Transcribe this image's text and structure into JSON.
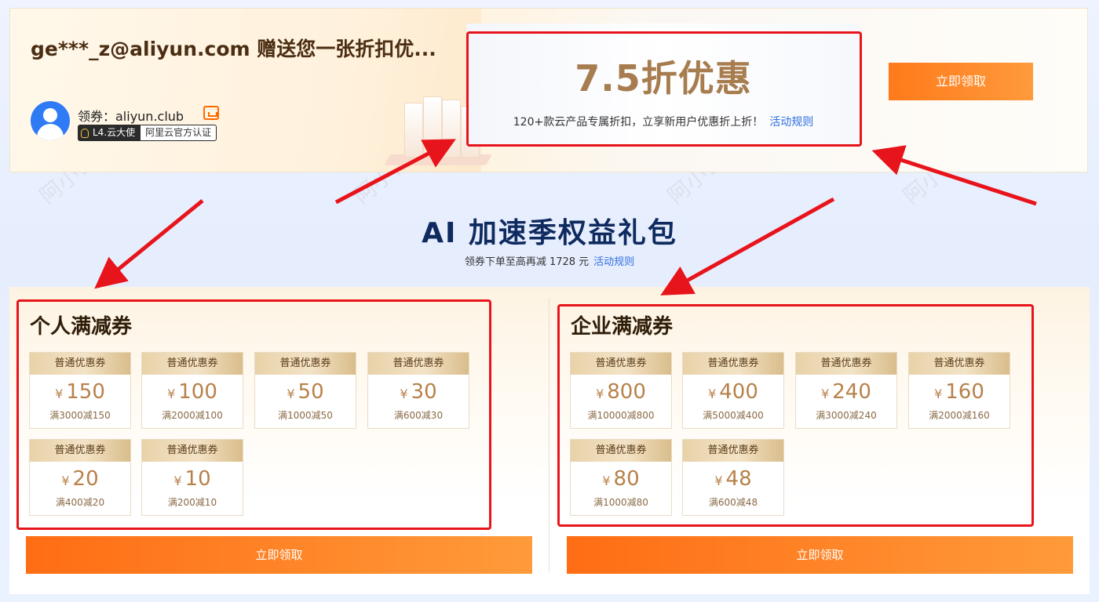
{
  "banner": {
    "title": "ge***_z@aliyun.com 赠送您一张折扣优...",
    "receiver_label": "领券：aliyun.club",
    "badge_level": "L4.云大使",
    "badge_cert": "阿里云官方认证",
    "discount_title": "7.5折优惠",
    "discount_desc": "120+款云产品专属折扣，立享新用户优惠折上折！",
    "discount_rule_link": "活动规则",
    "claim_label": "立即领取"
  },
  "section": {
    "title": "AI 加速季权益礼包",
    "subtitle": "领券下单至高再减 1728 元",
    "rule_link": "活动规则"
  },
  "personal": {
    "title": "个人满减券",
    "claim_label": "立即领取",
    "coupons": [
      {
        "head": "普通优惠券",
        "yen": "¥",
        "amount": "150",
        "rule": "满3000减150"
      },
      {
        "head": "普通优惠券",
        "yen": "¥",
        "amount": "100",
        "rule": "满2000减100"
      },
      {
        "head": "普通优惠券",
        "yen": "¥",
        "amount": "50",
        "rule": "满1000减50"
      },
      {
        "head": "普通优惠券",
        "yen": "¥",
        "amount": "30",
        "rule": "满600减30"
      },
      {
        "head": "普通优惠券",
        "yen": "¥",
        "amount": "20",
        "rule": "满400减20"
      },
      {
        "head": "普通优惠券",
        "yen": "¥",
        "amount": "10",
        "rule": "满200减10"
      }
    ]
  },
  "enterprise": {
    "title": "企业满减券",
    "claim_label": "立即领取",
    "coupons": [
      {
        "head": "普通优惠券",
        "yen": "¥",
        "amount": "800",
        "rule": "满10000减800"
      },
      {
        "head": "普通优惠券",
        "yen": "¥",
        "amount": "400",
        "rule": "满5000减400"
      },
      {
        "head": "普通优惠券",
        "yen": "¥",
        "amount": "240",
        "rule": "满3000减240"
      },
      {
        "head": "普通优惠券",
        "yen": "¥",
        "amount": "160",
        "rule": "满2000减160"
      },
      {
        "head": "普通优惠券",
        "yen": "¥",
        "amount": "80",
        "rule": "满1000减80"
      },
      {
        "head": "普通优惠券",
        "yen": "¥",
        "amount": "48",
        "rule": "满600减48"
      }
    ]
  },
  "watermark": "阿小云 axiaoyun.com",
  "colors": {
    "accent_orange": "#ff7a1a",
    "gold_text": "#a77c4f",
    "link_blue": "#2f6ee0",
    "annotation_red": "#e8141b",
    "title_navy": "#0f2a5f"
  }
}
